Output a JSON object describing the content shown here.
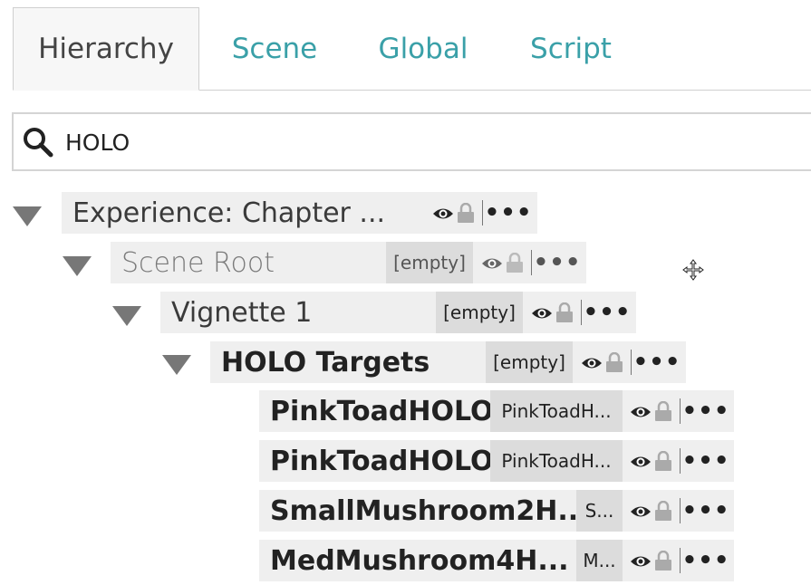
{
  "tabs": [
    {
      "label": "Hierarchy",
      "active": true
    },
    {
      "label": "Scene",
      "active": false
    },
    {
      "label": "Global",
      "active": false
    },
    {
      "label": "Script",
      "active": false
    }
  ],
  "search": {
    "value": "HOLO",
    "icon": "search-icon"
  },
  "tree": [
    {
      "name": "Experience: Chapter ...",
      "pill": "",
      "style": "normal",
      "expanded": true
    },
    {
      "name": "Scene Root",
      "pill": "[empty]",
      "style": "light",
      "expanded": true
    },
    {
      "name": "Vignette 1",
      "pill": "[empty]",
      "style": "normal",
      "expanded": true
    },
    {
      "name": "HOLO Targets",
      "pill": "[empty]",
      "style": "bold",
      "expanded": true
    },
    {
      "name": "PinkToadHOLO",
      "pill": "PinkToadH...",
      "style": "bold"
    },
    {
      "name": "PinkToadHOLO",
      "pill": "PinkToadH...",
      "style": "bold"
    },
    {
      "name": "SmallMushroom2H...",
      "pill": "S...",
      "style": "bold"
    },
    {
      "name": "MedMushroom4H...",
      "pill": "M...",
      "style": "bold"
    }
  ],
  "row_actions": {
    "more_label": "•••",
    "visibility_icon": "eye-icon",
    "lock_icon": "lock-icon"
  },
  "colors": {
    "accent": "#3aa0a8",
    "row_bg": "#efefef",
    "pill_bg": "#dcdcdc"
  }
}
